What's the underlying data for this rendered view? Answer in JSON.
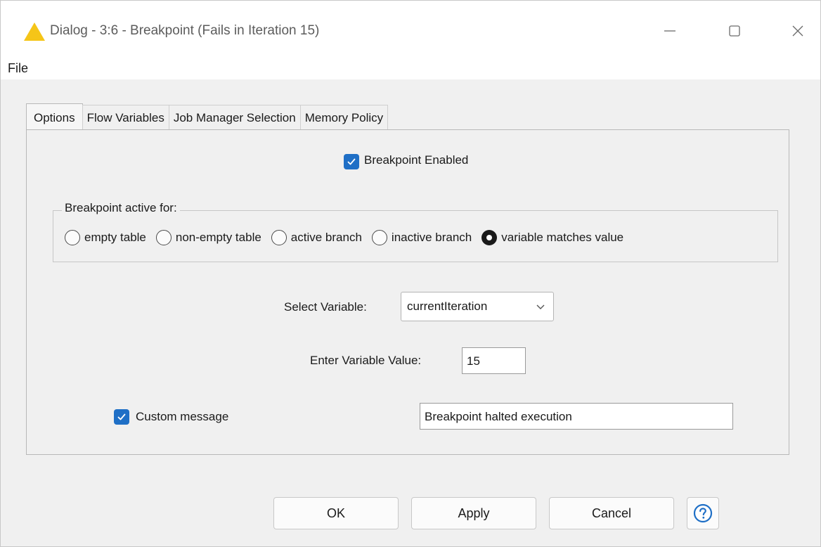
{
  "window": {
    "title": "Dialog - 3:6 - Breakpoint (Fails in Iteration 15)"
  },
  "menu": {
    "file": "File"
  },
  "tabs": [
    {
      "label": "Options",
      "active": true
    },
    {
      "label": "Flow Variables",
      "active": false
    },
    {
      "label": "Job Manager Selection",
      "active": false
    },
    {
      "label": "Memory Policy",
      "active": false
    }
  ],
  "options": {
    "breakpoint_enabled": {
      "label": "Breakpoint Enabled",
      "checked": true
    },
    "active_for": {
      "title": "Breakpoint active for:",
      "options": [
        {
          "label": "empty table",
          "selected": false
        },
        {
          "label": "non-empty table",
          "selected": false
        },
        {
          "label": "active branch",
          "selected": false
        },
        {
          "label": "inactive branch",
          "selected": false
        },
        {
          "label": "variable matches value",
          "selected": true
        }
      ]
    },
    "select_variable": {
      "label": "Select Variable:",
      "value": "currentIteration"
    },
    "variable_value": {
      "label": "Enter Variable Value:",
      "value": "15"
    },
    "custom_message": {
      "label": "Custom message",
      "checked": true,
      "value": "Breakpoint halted execution"
    }
  },
  "buttons": {
    "ok": "OK",
    "apply": "Apply",
    "cancel": "Cancel",
    "help_icon": "question-circle-icon"
  },
  "colors": {
    "accent": "#1f6fc6",
    "warning_icon": "#f5c518"
  }
}
